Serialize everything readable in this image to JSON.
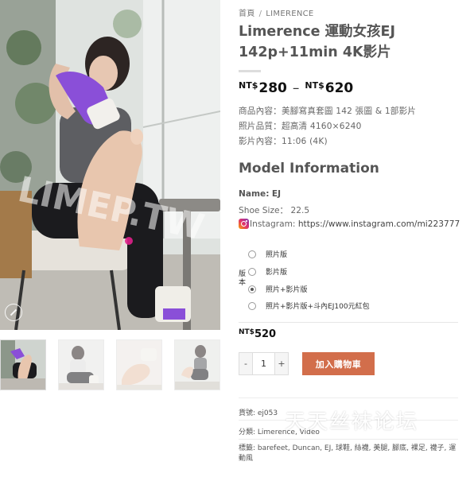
{
  "breadcrumb": {
    "home": "首頁",
    "separator": "/",
    "category": "LIMERENCE"
  },
  "product": {
    "title_line1": "Limerence 運動女孩EJ",
    "title_line2": "142p+11min 4K影片",
    "price_range": {
      "currency": "NT$",
      "min": "280",
      "dash": "–",
      "max": "620"
    },
    "details": [
      {
        "label": "商品內容：",
        "value": "美腳寫真套圖 142 張圖 & 1部影片"
      },
      {
        "label": "照片品質：",
        "value": "超高清 4160×6240"
      },
      {
        "label": "影片內容：",
        "value": "11:06 (4K)"
      }
    ]
  },
  "model": {
    "heading": "Model Information",
    "name_label": "Name:",
    "name_value": "EJ",
    "shoe_label": "Shoe Size：",
    "shoe_value": "22.5",
    "instagram_label": "Instagram:",
    "instagram_url": "https://www.instagram.com/mi223777"
  },
  "variation": {
    "label": "版本",
    "options": [
      {
        "label": "照片版",
        "checked": false
      },
      {
        "label": "影片版",
        "checked": false
      },
      {
        "label": "照片+影片版",
        "checked": true
      },
      {
        "label": "照片+影片版+斗內EJ100元紅包",
        "checked": false
      }
    ]
  },
  "selected_price": {
    "currency": "NT$",
    "amount": "520"
  },
  "cart": {
    "minus": "-",
    "quantity": "1",
    "plus": "+",
    "add_label": "加入購物車"
  },
  "meta": {
    "sku": "貨號: ej053",
    "category": "分類: Limerence, Video",
    "tags": "標籤: barefeet, Duncan, EJ, 球鞋, 絲襪, 美腿, 腳底, 裸足, 襪子, 運動風"
  },
  "watermark": "天天丝袜论坛",
  "photo_watermark": "LIMEP.TW",
  "colors": {
    "accent": "#d26e4b",
    "sock_purple": "#8a4fd8",
    "instagram": "#e1306c"
  },
  "icons": {
    "zoom": "zoom-icon",
    "instagram": "instagram-icon"
  }
}
